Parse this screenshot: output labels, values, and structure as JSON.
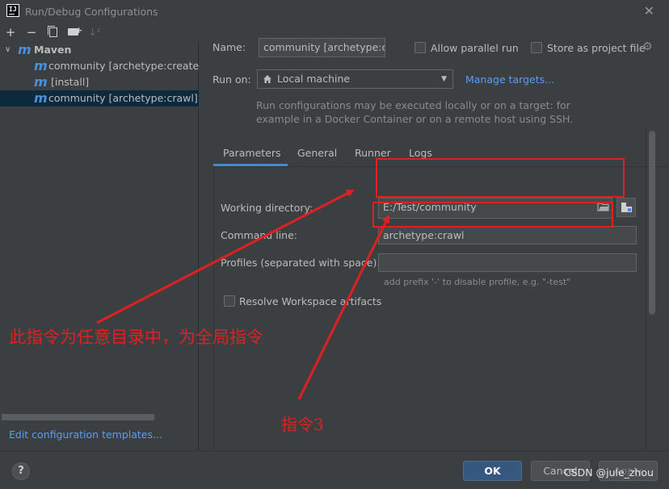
{
  "window": {
    "title": "Run/Debug Configurations",
    "logo_text": "IJ"
  },
  "toolbar": {
    "add": "+",
    "remove": "−",
    "sort": "↓²"
  },
  "tree": {
    "group_label": "Maven",
    "items": [
      {
        "label": "community [archetype:create-from-project]"
      },
      {
        "label": "[install]"
      },
      {
        "label": "community [archetype:crawl]"
      }
    ],
    "edit_templates_link": "Edit configuration templates..."
  },
  "form": {
    "name_label": "Name:",
    "name_value": "community [archetype:crawl]",
    "allow_parallel_label": "Allow parallel run",
    "store_project_label": "Store as project file",
    "run_on_label": "Run on:",
    "run_on_value": "Local machine",
    "manage_targets": "Manage targets...",
    "hint_line1": "Run configurations may be executed locally or on a target: for",
    "hint_line2": "example in a Docker Container or on a remote host using SSH."
  },
  "tabs": [
    {
      "label": "Parameters"
    },
    {
      "label": "General"
    },
    {
      "label": "Runner"
    },
    {
      "label": "Logs"
    }
  ],
  "params": {
    "working_dir_label": "Working directory:",
    "working_dir_value": "E:/Test/community",
    "command_line_label": "Command line:",
    "command_line_value": "archetype:crawl",
    "profiles_label": "Profiles (separated with space):",
    "profiles_value": "",
    "profiles_hint": "add prefix '-' to disable profile, e.g. \"-test\"",
    "resolve_workspace_label": "Resolve Workspace artifacts"
  },
  "footer": {
    "help": "?",
    "ok": "OK",
    "cancel": "Cancel",
    "apply": "Apply"
  },
  "annotations": {
    "note_global": "此指令为任意目录中，为全局指令",
    "note_cmd3": "指令3",
    "color": "#e02020"
  },
  "watermark": "CSDN @jule_zhou"
}
